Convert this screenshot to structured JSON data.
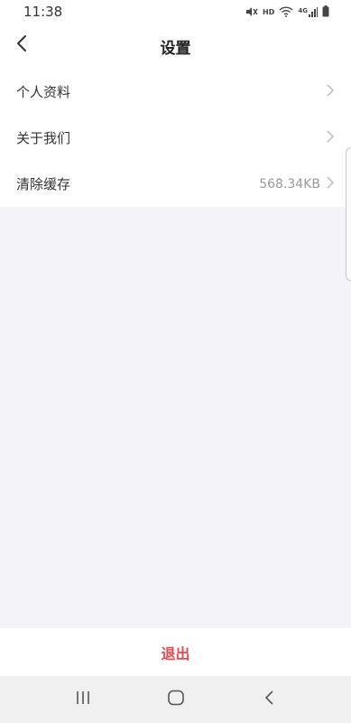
{
  "status_bar": {
    "time": "11:38",
    "hd": "HD",
    "network": "4G"
  },
  "header": {
    "title": "设置"
  },
  "settings": {
    "items": [
      {
        "label": "个人资料",
        "value": ""
      },
      {
        "label": "关于我们",
        "value": ""
      },
      {
        "label": "清除缓存",
        "value": "568.34KB"
      }
    ]
  },
  "logout": {
    "label": "退出"
  },
  "colors": {
    "logout_text": "#e64a4a",
    "background": "#f4f4f8"
  }
}
